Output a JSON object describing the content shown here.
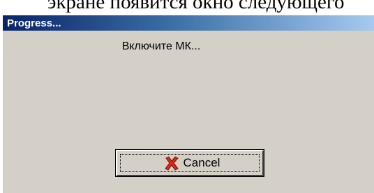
{
  "document": {
    "text": "экране появится окно следующего"
  },
  "dialog": {
    "title": "Progress...",
    "message": "Включите МК...",
    "cancel_label": "Cancel",
    "cancel_icon": "red-x-icon"
  },
  "colors": {
    "dialog_bg": "#d4d0c8",
    "titlebar_start": "#0a246a",
    "titlebar_end": "#a6caf0",
    "icon_red": "#d42a1a"
  }
}
